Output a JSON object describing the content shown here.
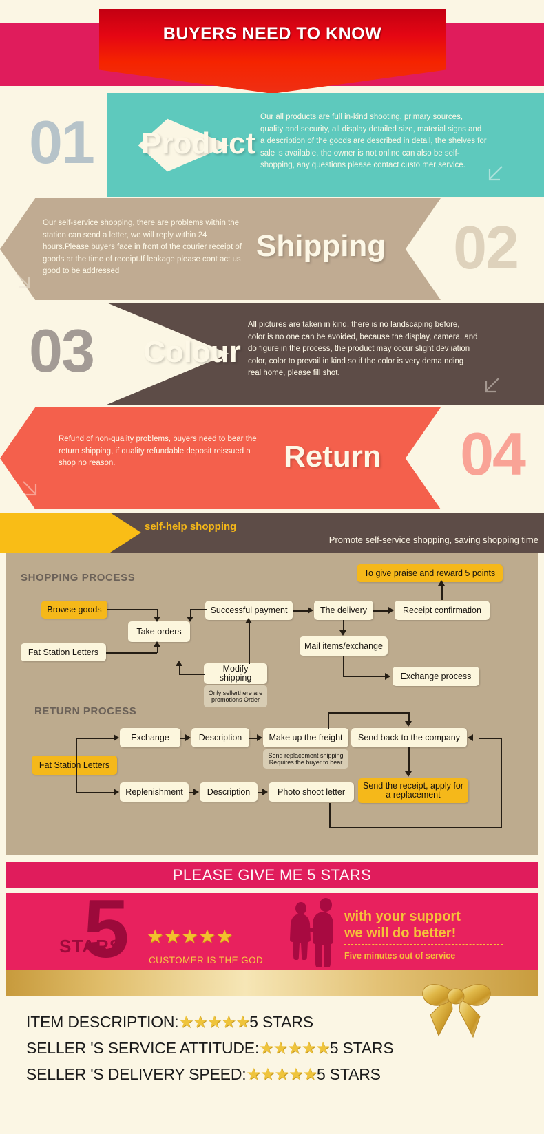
{
  "header": {
    "title": "BUYERS NEED TO KNOW"
  },
  "sections": [
    {
      "number": "01",
      "title": "Product",
      "body": "Our all products are full in-kind shooting, primary sources, quality and security, all display detailed size, material signs and a description of the goods are described in detail, the shelves for sale is available, the owner is not online can also be self-shopping, any questions please contact custo mer service.",
      "accent": "#5ec9bd"
    },
    {
      "number": "02",
      "title": "Shipping",
      "body": "Our self-service shopping, there are problems within the station can send a letter, we will reply within 24 hours.Please buyers face in front of the courier receipt  of goods at the time of receipt.If leakage please cont act us good to be addressed",
      "accent": "#c0ab92"
    },
    {
      "number": "03",
      "title": "Colour",
      "body": "All pictures are taken in kind, there is no landscaping before, color is no one can be avoided, because the display, camera, and do figure in the process, the product may occur slight dev iation color, color to prevail in kind so if the color is very dema nding real home, please fill shot.",
      "accent": "#5d4c47"
    },
    {
      "number": "04",
      "title": "Return",
      "body": "Refund of non-quality problems, buyers need to bear the return shipping, if quality refundable deposit reissued a shop no reason.",
      "accent": "#f4604c"
    }
  ],
  "selfhelp": {
    "label": "self-help shopping",
    "subtitle": "Promote self-service shopping, saving shopping time"
  },
  "flow": {
    "shopping_title": "SHOPPING PROCESS",
    "return_title": "RETURN PROCESS",
    "shopping_nodes": {
      "browse_goods": "Browse goods",
      "fat_station_letters": "Fat Station Letters",
      "take_orders": "Take orders",
      "modify_shipping": "Modify shipping",
      "modify_note": "Only sellerthere are promotions Order",
      "successful_payment": "Successful payment",
      "the_delivery": "The delivery",
      "receipt_confirmation": "Receipt confirmation",
      "praise_reward": "To give praise and reward 5 points",
      "mail_items": "Mail items/exchange",
      "exchange_process": "Exchange process"
    },
    "return_nodes": {
      "fat_station_letters": "Fat Station Letters",
      "exchange": "Exchange",
      "description1": "Description",
      "make_up_freight": "Make up the freight",
      "freight_note": "Send replacement shipping Requires the buyer to bear",
      "send_back": "Send back to the company",
      "replenishment": "Replenishment",
      "description2": "Description",
      "photo_shoot_letter": "Photo shoot letter",
      "send_receipt": "Send the receipt, apply for a replacement"
    }
  },
  "please_give": {
    "text": "PLEASE GIVE ME 5 STARS"
  },
  "stars_banner": {
    "big_number": "5",
    "stars_word": "STARS",
    "stars_glyphs": "★★★★★",
    "customer_god": "CUSTOMER IS THE GOD",
    "support_line1": "with your support",
    "support_line2": "we will do better!",
    "five_minutes": "Five minutes out of service"
  },
  "ratings": [
    {
      "label": "ITEM DESCRIPTION:",
      "stars": "★★★★★",
      "value": "5 STARS"
    },
    {
      "label": "SELLER  'S SERVICE ATTITUDE:",
      "stars": "★★★★★",
      "value": "5 STARS"
    },
    {
      "label": "SELLER  'S DELIVERY SPEED:",
      "stars": "★★★★★",
      "value": "5 STARS"
    }
  ],
  "colors": {
    "pink": "#e01c5c",
    "red": "#e50613",
    "teal": "#5ec9bd",
    "tan": "#c0ab92",
    "brown": "#5d4c47",
    "coral": "#f4604c",
    "yellow": "#f9bd16",
    "cream": "#fbf6e4"
  }
}
